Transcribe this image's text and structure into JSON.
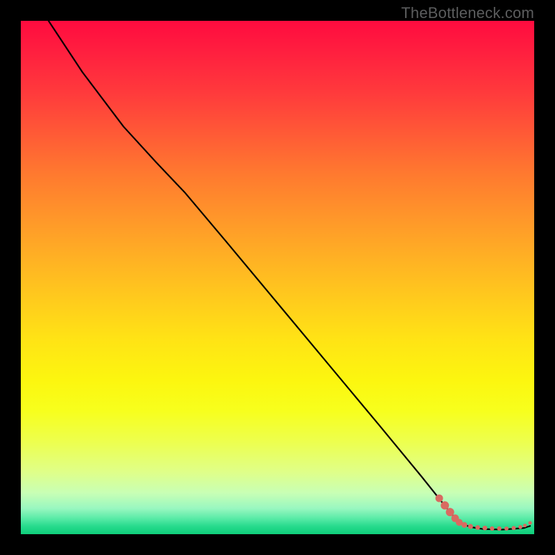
{
  "watermark": "TheBottleneck.com",
  "colors": {
    "point_fill": "#d96a61",
    "curve_stroke": "#000000"
  },
  "chart_data": {
    "type": "line",
    "title": "",
    "xlabel": "",
    "ylabel": "",
    "xlim": [
      0,
      100
    ],
    "ylim": [
      0,
      100
    ],
    "grid": false,
    "note": "No axis ticks/labels present; values are read as percentage of plot extent.",
    "curve": [
      {
        "x": 5.4,
        "y": 100.0
      },
      {
        "x": 12.0,
        "y": 90.0
      },
      {
        "x": 20.0,
        "y": 79.4
      },
      {
        "x": 26.4,
        "y": 72.4
      },
      {
        "x": 32.0,
        "y": 66.5
      },
      {
        "x": 40.0,
        "y": 57.0
      },
      {
        "x": 50.0,
        "y": 45.0
      },
      {
        "x": 60.0,
        "y": 33.0
      },
      {
        "x": 70.0,
        "y": 21.0
      },
      {
        "x": 78.0,
        "y": 11.3
      },
      {
        "x": 82.0,
        "y": 6.3
      },
      {
        "x": 84.0,
        "y": 3.8
      },
      {
        "x": 85.8,
        "y": 2.2
      },
      {
        "x": 87.5,
        "y": 1.4
      },
      {
        "x": 90.0,
        "y": 1.0
      },
      {
        "x": 94.0,
        "y": 0.9
      },
      {
        "x": 98.0,
        "y": 1.2
      },
      {
        "x": 99.2,
        "y": 1.6
      }
    ],
    "points": [
      {
        "x": 81.5,
        "y": 7.0,
        "r": 5.5
      },
      {
        "x": 82.6,
        "y": 5.6,
        "r": 6.0
      },
      {
        "x": 83.6,
        "y": 4.3,
        "r": 6.0
      },
      {
        "x": 84.6,
        "y": 3.1,
        "r": 5.5
      },
      {
        "x": 85.4,
        "y": 2.3,
        "r": 5.0
      },
      {
        "x": 86.4,
        "y": 1.8,
        "r": 4.2
      },
      {
        "x": 87.6,
        "y": 1.5,
        "r": 3.6
      },
      {
        "x": 89.0,
        "y": 1.3,
        "r": 3.4
      },
      {
        "x": 90.4,
        "y": 1.2,
        "r": 3.4
      },
      {
        "x": 91.8,
        "y": 1.1,
        "r": 3.2
      },
      {
        "x": 93.2,
        "y": 1.1,
        "r": 3.2
      },
      {
        "x": 94.6,
        "y": 1.1,
        "r": 3.0
      },
      {
        "x": 96.0,
        "y": 1.2,
        "r": 3.0
      },
      {
        "x": 97.3,
        "y": 1.4,
        "r": 2.8
      },
      {
        "x": 98.2,
        "y": 1.7,
        "r": 2.6
      },
      {
        "x": 99.2,
        "y": 2.2,
        "r": 2.6
      }
    ]
  }
}
